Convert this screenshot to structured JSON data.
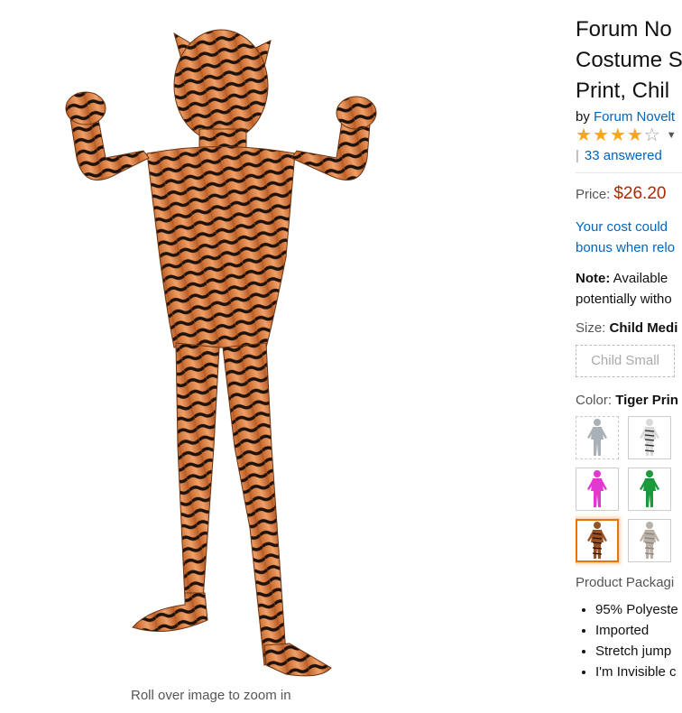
{
  "image": {
    "zoom_hint": "Roll over image to zoom in"
  },
  "product": {
    "title_lines": [
      "Forum No",
      "Costume S",
      "Print, Chil"
    ],
    "by_prefix": "by",
    "brand": "Forum Novelt",
    "rating": 4.0,
    "answered_sep": "|",
    "answered": "33 answered",
    "price_label": "Price:",
    "price": "$26.20",
    "cost_lines": [
      "Your cost could",
      "bonus when relo"
    ],
    "note_label": "Note:",
    "note_lines": [
      "Available",
      "potentially witho"
    ],
    "size_label": "Size:",
    "size_value": "Child Medi",
    "size_option": "Child Small",
    "color_label": "Color:",
    "color_value": "Tiger Prin",
    "colors": [
      {
        "name": "silver-suit-icon",
        "hex": "#a9b0b8",
        "stripe": "",
        "state": "unavailable"
      },
      {
        "name": "black-white-suit-icon",
        "hex": "#d9d9d9",
        "stripe": "#222222",
        "state": "normal"
      },
      {
        "name": "pink-suit-icon",
        "hex": "#e23ad0",
        "stripe": "",
        "state": "normal"
      },
      {
        "name": "green-suit-icon",
        "hex": "#1a9a3a",
        "stripe": "",
        "state": "normal"
      },
      {
        "name": "tiger-suit-icon",
        "hex": "#9a4f22",
        "stripe": "#1c120c",
        "state": "selected"
      },
      {
        "name": "gray-suit-icon",
        "hex": "#b9b1a8",
        "stripe": "#8a8078",
        "state": "normal"
      }
    ],
    "packaging": "Product Packagi",
    "bullets": [
      "95% Polyeste",
      "Imported",
      "Stretch jump",
      "I'm Invisible c"
    ]
  }
}
